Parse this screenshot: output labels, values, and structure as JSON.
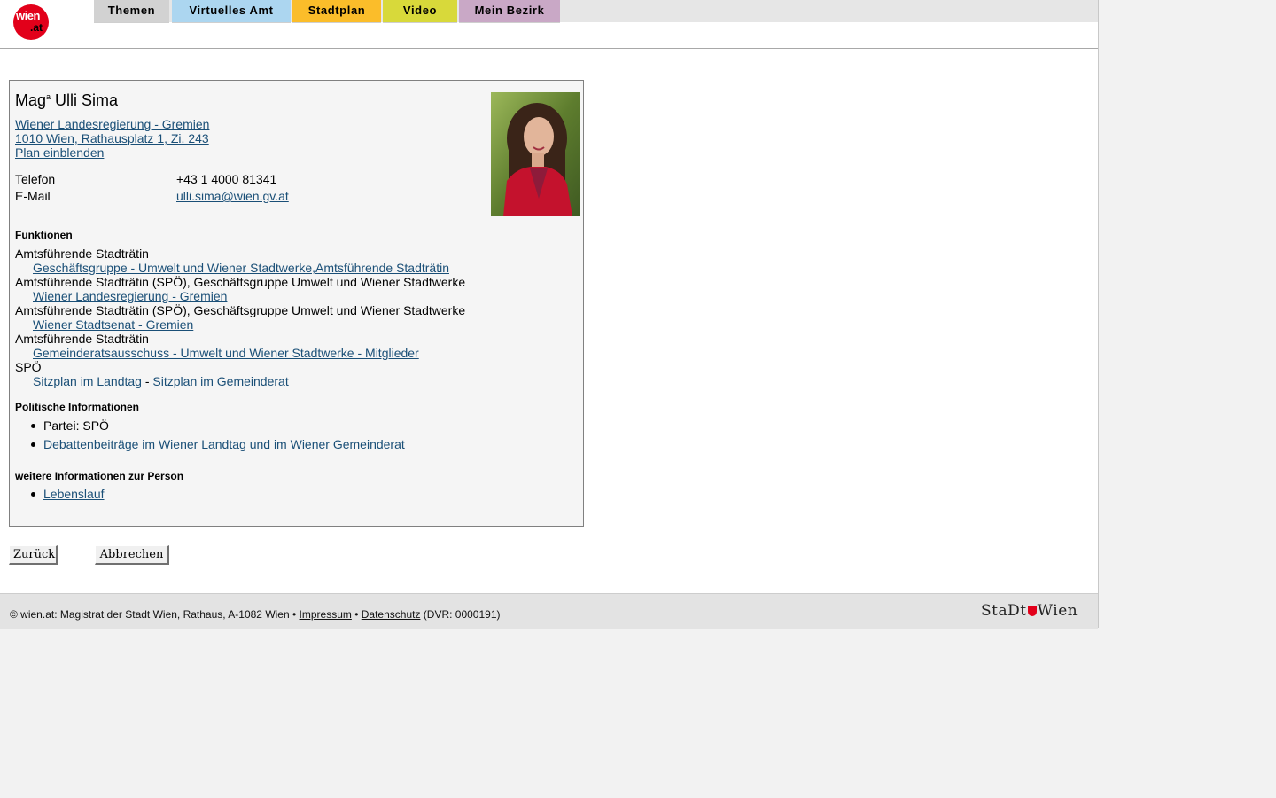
{
  "header": {
    "logo_top": "wien",
    "logo_bottom": "at",
    "tabs": [
      {
        "label": "Themen",
        "color": "#d2d2d2"
      },
      {
        "label": "Virtuelles Amt",
        "color": "#acd6f0"
      },
      {
        "label": "Stadtplan",
        "color": "#fbbd2a"
      },
      {
        "label": "Video",
        "color": "#d8d93a"
      },
      {
        "label": "Mein Bezirk",
        "color": "#c9a8c6"
      }
    ]
  },
  "person": {
    "name_prefix": "Mag",
    "name_sup": "a",
    "name": "Ulli Sima",
    "org_link": "Wiener Landesregierung - Gremien ",
    "address_link": "1010 Wien, Rathausplatz 1, Zi. 243",
    "map_link": "Plan einblenden",
    "phone_label": "Telefon",
    "phone_value": "+43 1 4000 81341",
    "email_label": "E-Mail",
    "email_value": "ulli.sima@wien.gv.at"
  },
  "functions": {
    "heading": "Funktionen",
    "items": [
      {
        "role": "Amtsführende Stadträtin",
        "link": "Geschäftsgruppe - Umwelt und Wiener Stadtwerke,Amtsführende Stadträtin"
      },
      {
        "role": "Amtsführende Stadträtin (SPÖ), Geschäftsgruppe Umwelt und Wiener Stadtwerke",
        "link": "Wiener Landesregierung - Gremien"
      },
      {
        "role": "Amtsführende Stadträtin (SPÖ), Geschäftsgruppe Umwelt und Wiener Stadtwerke",
        "link": "Wiener Stadtsenat - Gremien"
      },
      {
        "role": "Amtsführende Stadträtin",
        "link": "Gemeinderatsausschuss - Umwelt und Wiener Stadtwerke - Mitglieder"
      }
    ],
    "party": "SPÖ",
    "seat_landtag": "Sitzplan im Landtag",
    "seat_separator": " - ",
    "seat_gemeinderat": "Sitzplan im Gemeinderat"
  },
  "political": {
    "heading": "Politische Informationen",
    "party_item": "Partei: SPÖ",
    "debate_link": "Debattenbeiträge im Wiener Landtag und im Wiener Gemeinderat"
  },
  "more": {
    "heading": "weitere Informationen zur Person",
    "cv_link": "Lebenslauf"
  },
  "buttons": {
    "back": "Zurück",
    "cancel": "Abbrechen"
  },
  "footer": {
    "text_start": "© wien.at: Magistrat der Stadt Wien, Rathaus, A-1082 Wien • ",
    "impressum": "Impressum",
    "bullet": " • ",
    "datenschutz": "Datenschutz",
    "text_end": " (DVR: 0000191)",
    "logo_left": "StaDt",
    "logo_right": "Wien"
  }
}
